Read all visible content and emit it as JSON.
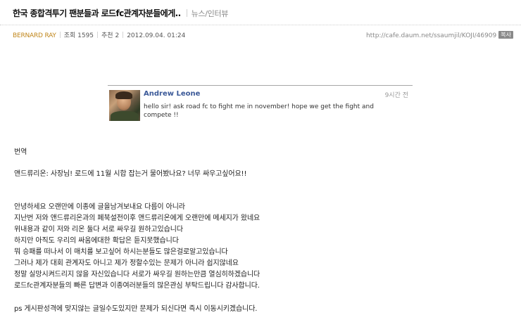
{
  "header": {
    "title": "한국 종합격투기 팬분들과 로드fc관계자분들에게..",
    "category": "뉴스/인터뷰"
  },
  "meta": {
    "author": "BERNARD RAY",
    "views": "조회 1595",
    "recommend": "추천 2",
    "datetime": "2012.09.04. 01:24",
    "url": "http://cafe.daum.net/ssaumjil/KOJI/46909",
    "copy_label": "복사"
  },
  "embed": {
    "name": "Andrew Leone",
    "time": "9시간 전",
    "message": "hello sir! ask road fc to fight me in november! hope we get the fight and compete !!"
  },
  "body": {
    "translation_label": "번역",
    "translation": "앤드류리온: 사장님! 로드에 11월 시합 잡는거 물어봤나요? 너무 싸우고싶어요!!",
    "paragraph": [
      "안녕하세요 오랜만에 이종에 글을남겨보내요 다름이 아니라",
      "지난번 저와 앤드류리온과의 페북설전이후 앤드류리온에게 오랜만에 메세지가 왔네요",
      "위내용과 같이 저와 리온 둘다 서로 싸우길 원하고있습니다",
      "하지만 아직도 우리의 싸움에대한 확답은 듣지못했습니다",
      "뭐 승패를 떠나서 이 매치를 보고싶어 하시는분들도 많은걸로알고있습니다",
      "그러나 제가 대회 관계자도 아니고 제가 정할수있는 문제가 아니라 쉽지않네요",
      "정말 실망시켜드리지 않을 자신있습니다 서로가 싸우길 원하는만큼 열심히하겠습니다",
      "로드fc관계자분들의 빠른 답변과 이종여러분들의 많은관심 부탁드립니다 감사합니다."
    ],
    "ps": "ps 게시판성격에 맞지않는 글일수도있지만 문제가 되신다면 즉시 이동시키겠습니다."
  }
}
